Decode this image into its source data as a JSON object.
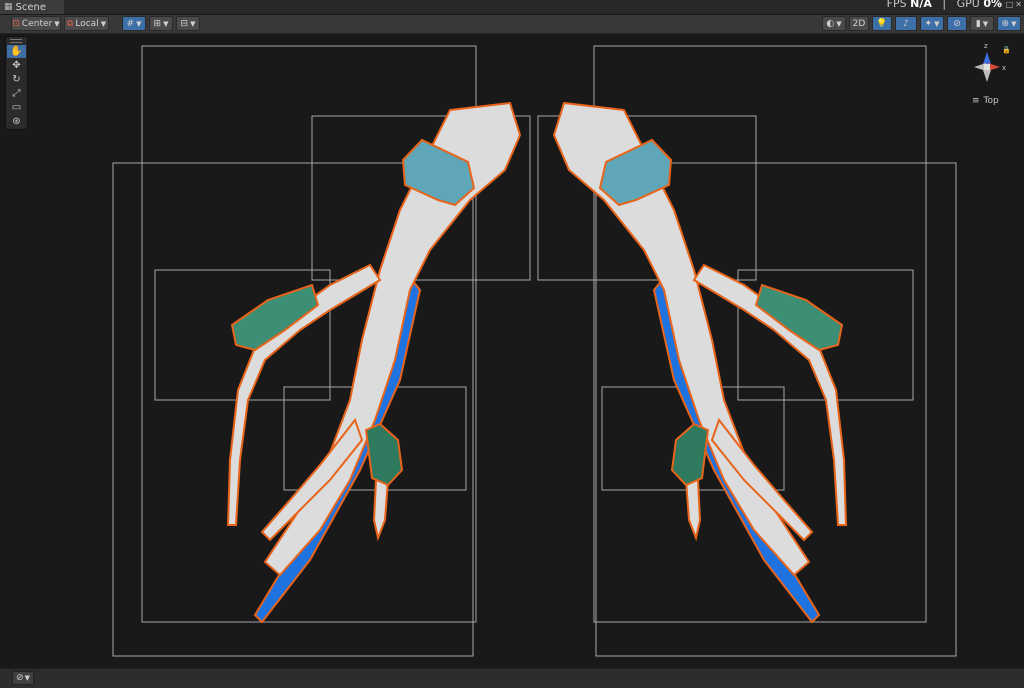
{
  "tab": {
    "label": "Scene"
  },
  "stats": {
    "fps_label": "FPS",
    "fps_value": "N/A",
    "separator": "|",
    "gpu_label": "GPU",
    "gpu_value": "0%"
  },
  "toolbar": {
    "pivot_mode": "Center",
    "pivot_rotation": "Local",
    "mode_2d": "2D"
  },
  "gizmo": {
    "view": "Top",
    "menu_glyph": "≡",
    "axis_y": "z",
    "axis_x": "x"
  },
  "icons": {
    "tab": "scene-grid-icon",
    "tools": [
      "hand-icon",
      "move-icon",
      "rotate-icon",
      "scale-icon",
      "rect-icon",
      "transform-icon"
    ]
  },
  "colors": {
    "accent_blue": "#3f6ea5",
    "outline_orange": "#e8641a",
    "mesh_fill": "#dcdcdc",
    "mesh_blue": "#1e73e0",
    "toolbar_bg": "#383838",
    "viewport_bg": "#191919"
  }
}
